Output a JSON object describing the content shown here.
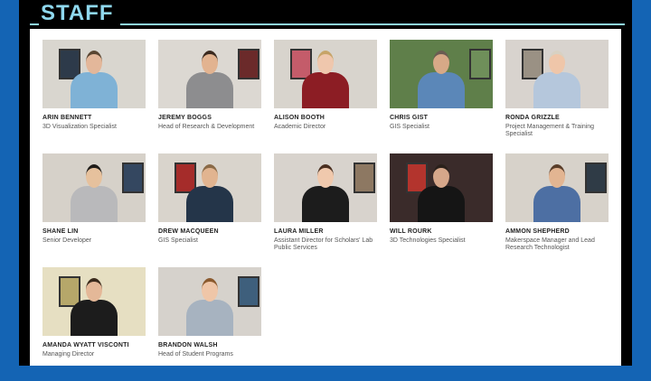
{
  "header": {
    "title": "STAFF"
  },
  "staff": [
    {
      "name": "ARIN BENNETT",
      "role": "3D Visualization Specialist",
      "bg": "#d9d6cf",
      "shirt": "#7fb2d6",
      "skin": "#e3b79a",
      "hair": "#5a4632",
      "poster": "#2d3a4a"
    },
    {
      "name": "JEREMY BOGGS",
      "role": "Head of Research & Development",
      "bg": "#dcd8d2",
      "shirt": "#8d8d8f",
      "skin": "#e2b390",
      "hair": "#3b2a1f",
      "poster": "#6b2a2a"
    },
    {
      "name": "ALISON BOOTH",
      "role": "Academic Director",
      "bg": "#d8d4cd",
      "shirt": "#8c1d24",
      "skin": "#efc7ad",
      "hair": "#c7a468",
      "poster": "#c45c6a"
    },
    {
      "name": "CHRIS GIST",
      "role": "GIS Specialist",
      "bg": "#5f7f4a",
      "shirt": "#5b87b8",
      "skin": "#d7a987",
      "hair": "#6a5d52",
      "poster": "#6f8f5a"
    },
    {
      "name": "RONDA GRIZZLE",
      "role": "Project Management & Training Specialist",
      "bg": "#d8d3ce",
      "shirt": "#b5c7dc",
      "skin": "#efc6a9",
      "hair": "#d8d1c2",
      "poster": "#9a9184"
    },
    {
      "name": "SHANE LIN",
      "role": "Senior Developer",
      "bg": "#d6d1c9",
      "shirt": "#b9b9bb",
      "skin": "#e6c19d",
      "hair": "#1f1c19",
      "poster": "#344760"
    },
    {
      "name": "DREW MACQUEEN",
      "role": "GIS Specialist",
      "bg": "#d9d4cc",
      "shirt": "#243549",
      "skin": "#e1b490",
      "hair": "#8a6a47",
      "poster": "#a52c2a"
    },
    {
      "name": "LAURA MILLER",
      "role": "Assistant Director for Scholars' Lab Public Services",
      "bg": "#d8d3cd",
      "shirt": "#1c1c1c",
      "skin": "#f0c9ad",
      "hair": "#4a2f20",
      "poster": "#8d7862"
    },
    {
      "name": "WILL ROURK",
      "role": "3D Technologies Specialist",
      "bg": "#3a2b2a",
      "shirt": "#151515",
      "skin": "#d6a78a",
      "hair": "#2b211b",
      "poster": "#b3342d"
    },
    {
      "name": "AMMON SHEPHERD",
      "role": "Makerspace Manager and Lead Research Technologist",
      "bg": "#d7d2ca",
      "shirt": "#4d6fa3",
      "skin": "#e2b592",
      "hair": "#5a3e2a",
      "poster": "#2f3b46"
    },
    {
      "name": "AMANDA WYATT VISCONTI",
      "role": "Managing Director",
      "bg": "#e6dfc2",
      "shirt": "#1c1c1c",
      "skin": "#e4b898",
      "hair": "#3a2a1c",
      "poster": "#b6a76a"
    },
    {
      "name": "BRANDON WALSH",
      "role": "Head of Student Programs",
      "bg": "#d6d2cc",
      "shirt": "#a7b3c0",
      "skin": "#efc6a8",
      "hair": "#8b5a2e",
      "poster": "#3e5f7c"
    }
  ]
}
